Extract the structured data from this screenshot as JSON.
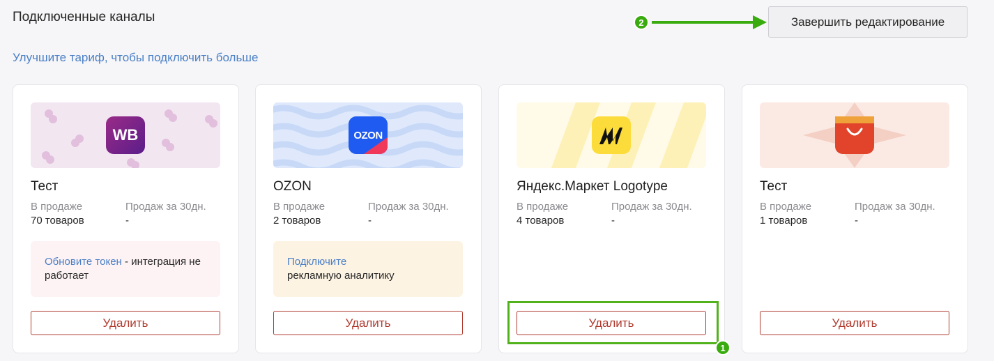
{
  "header": {
    "title": "Подключенные каналы",
    "upgrade_link": "Улучшите тариф, чтобы подключить больше",
    "finish_button": "Завершить редактирование"
  },
  "annotations": {
    "step_1": "1",
    "step_2": "2",
    "highlight_color": "#51b21c",
    "badge_color": "#3aab0f"
  },
  "labels": {
    "in_sale": "В продаже",
    "sales_30d": "Продаж за 30дн.",
    "delete": "Удалить"
  },
  "cards": [
    {
      "title": "Тест",
      "logo_icon": "wb-logo-icon",
      "logo_text": "WB",
      "in_sale": "70 товаров",
      "sales_30d": "-",
      "notice_link": "Обновите токен",
      "notice_text": " - интеграция не работает",
      "notice_bg": "#fdf3f4"
    },
    {
      "title": "OZON",
      "logo_icon": "ozon-logo-icon",
      "logo_text": "OZON",
      "in_sale": "2 товаров",
      "sales_30d": "-",
      "notice_link": "Подключите",
      "notice_text": "рекламную аналитику",
      "notice_bg": "#fdf3e3"
    },
    {
      "title": "Яндекс.Маркет Logotype",
      "logo_icon": "yandex-market-logo-icon",
      "in_sale": "4 товаров",
      "sales_30d": "-"
    },
    {
      "title": "Тест",
      "logo_icon": "shopping-bag-logo-icon",
      "in_sale": "1 товаров",
      "sales_30d": "-"
    }
  ]
}
